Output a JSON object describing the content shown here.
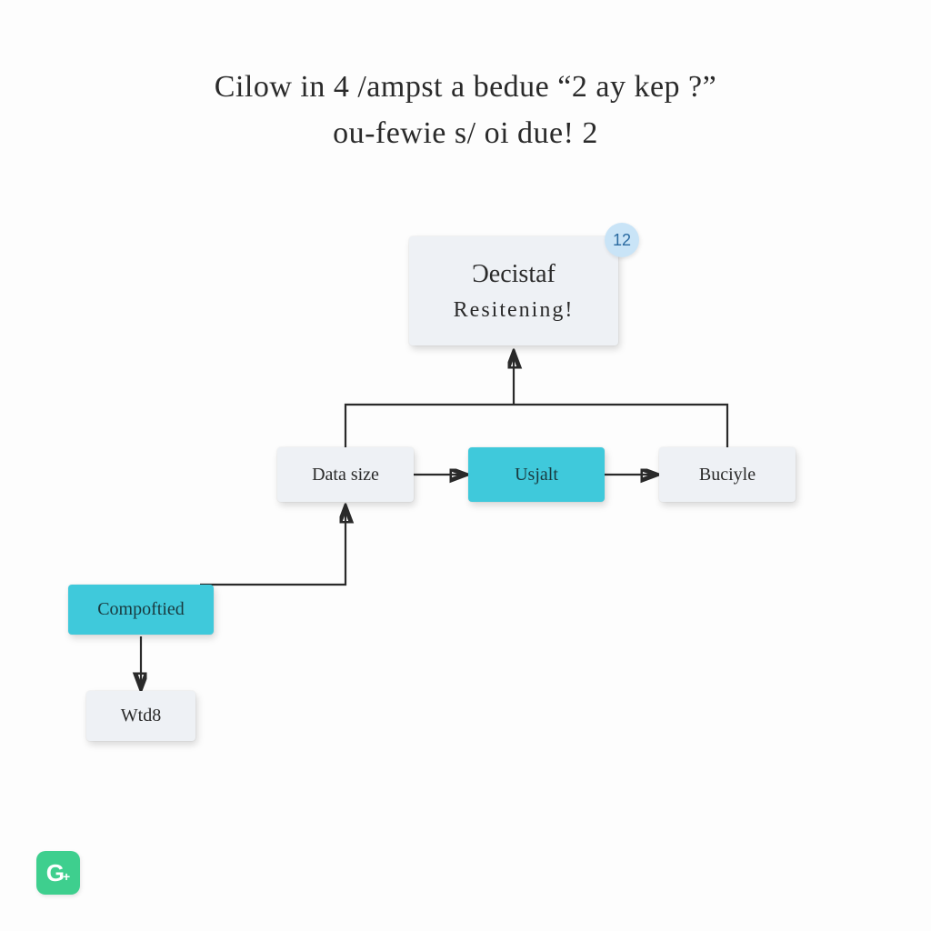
{
  "title": {
    "line1": "Cilow in 4 /ampst a bedue “2 ay kep ?”",
    "line2": "ou-fewie s/ oi due! 2"
  },
  "nodes": {
    "main": {
      "label_top": "Ɔecistaf",
      "label_bottom": "Resitening!"
    },
    "badge": "12",
    "data_size": "Data size",
    "usjalt": "Usjalt",
    "buciyle": "Buciyle",
    "compoftied": "Compoftied",
    "wtd8": "Wtd8"
  },
  "logo": {
    "letter": "G",
    "plus": "+"
  }
}
